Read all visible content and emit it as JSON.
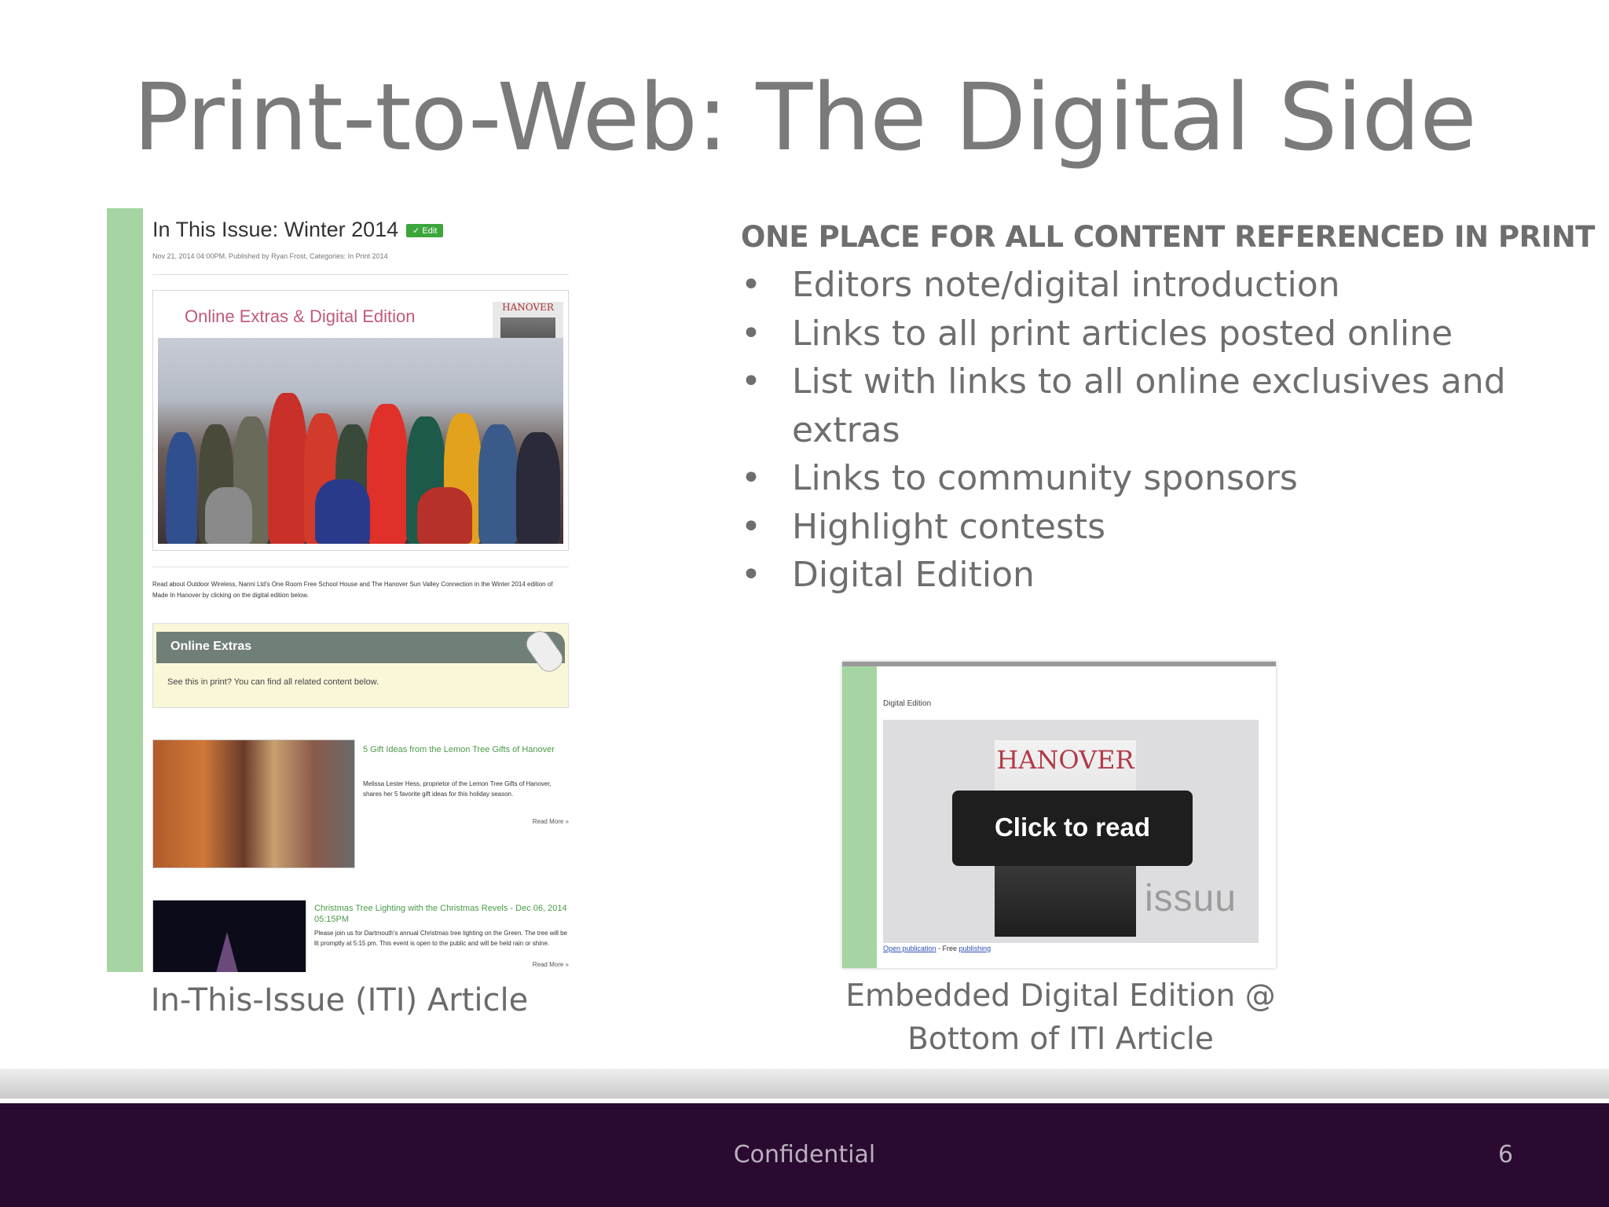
{
  "slide": {
    "title": "Print-to-Web: The Digital Side"
  },
  "iti_screenshot": {
    "title": "In This Issue: Winter 2014",
    "edit_badge": "✓ Edit",
    "meta": "Nov 21, 2014 04:00PM, Published by Ryan Frost, Categories: In Print 2014",
    "extras_heading": "Online Extras & Digital Edition",
    "cover_label": "HANOVER",
    "intro_text": "Read about Outdoor Wireless, Nanni Ltd's One Room Free School House and The Hanover Sun Valley Connection in the Winter 2014 edition of Made In Hanover by clicking on the digital edition below.",
    "online_extras_title": "Online Extras",
    "online_extras_sub": "See this in print? You can find all related content below.",
    "articles": [
      {
        "title": "5 Gift Ideas from the Lemon Tree Gifts of Hanover",
        "text": "Melissa Lester Hess, proprietor of the Lemon Tree Gifts of Hanover, shares her 5 favorite gift ideas for this holiday season.",
        "read_more": "Read More »"
      },
      {
        "title": "Christmas Tree Lighting with the Christmas Revels - Dec 06, 2014 05:15PM",
        "text": "Please join us for Dartmouth's annual Christmas tree lighting on the Green. The tree will be lit promptly at 5:15 pm. This event is open to the public and will be held rain or shine.",
        "read_more": "Read More »"
      }
    ]
  },
  "caption_left": "In-This-Issue (ITI) Article",
  "content": {
    "heading": "ONE PLACE FOR ALL CONTENT REFERENCED IN PRINT",
    "bullet_glyph": "•",
    "bullets": [
      "Editors note/digital introduction",
      "Links to all print articles posted online",
      "List with links to all online exclusives and extras",
      "Links to community sponsors",
      "Highlight contests",
      "Digital Edition"
    ]
  },
  "digital_edition": {
    "label": "Digital Edition",
    "magazine_title": "HANOVER",
    "overlay_text": "Click to read",
    "brand": "issuu",
    "link_open": "Open publication",
    "link_sep": " - Free ",
    "link_publish": "publishing"
  },
  "caption_right": {
    "line1": "Embedded Digital Edition @",
    "line2": "Bottom of ITI Article"
  },
  "footer": {
    "text": "Confidential",
    "page": "6"
  },
  "colors": {
    "accent_green": "#a6d5a3",
    "footer_purple": "#2a0a31",
    "title_gray": "#7a7a7a",
    "extras_pink": "#c05a78"
  }
}
